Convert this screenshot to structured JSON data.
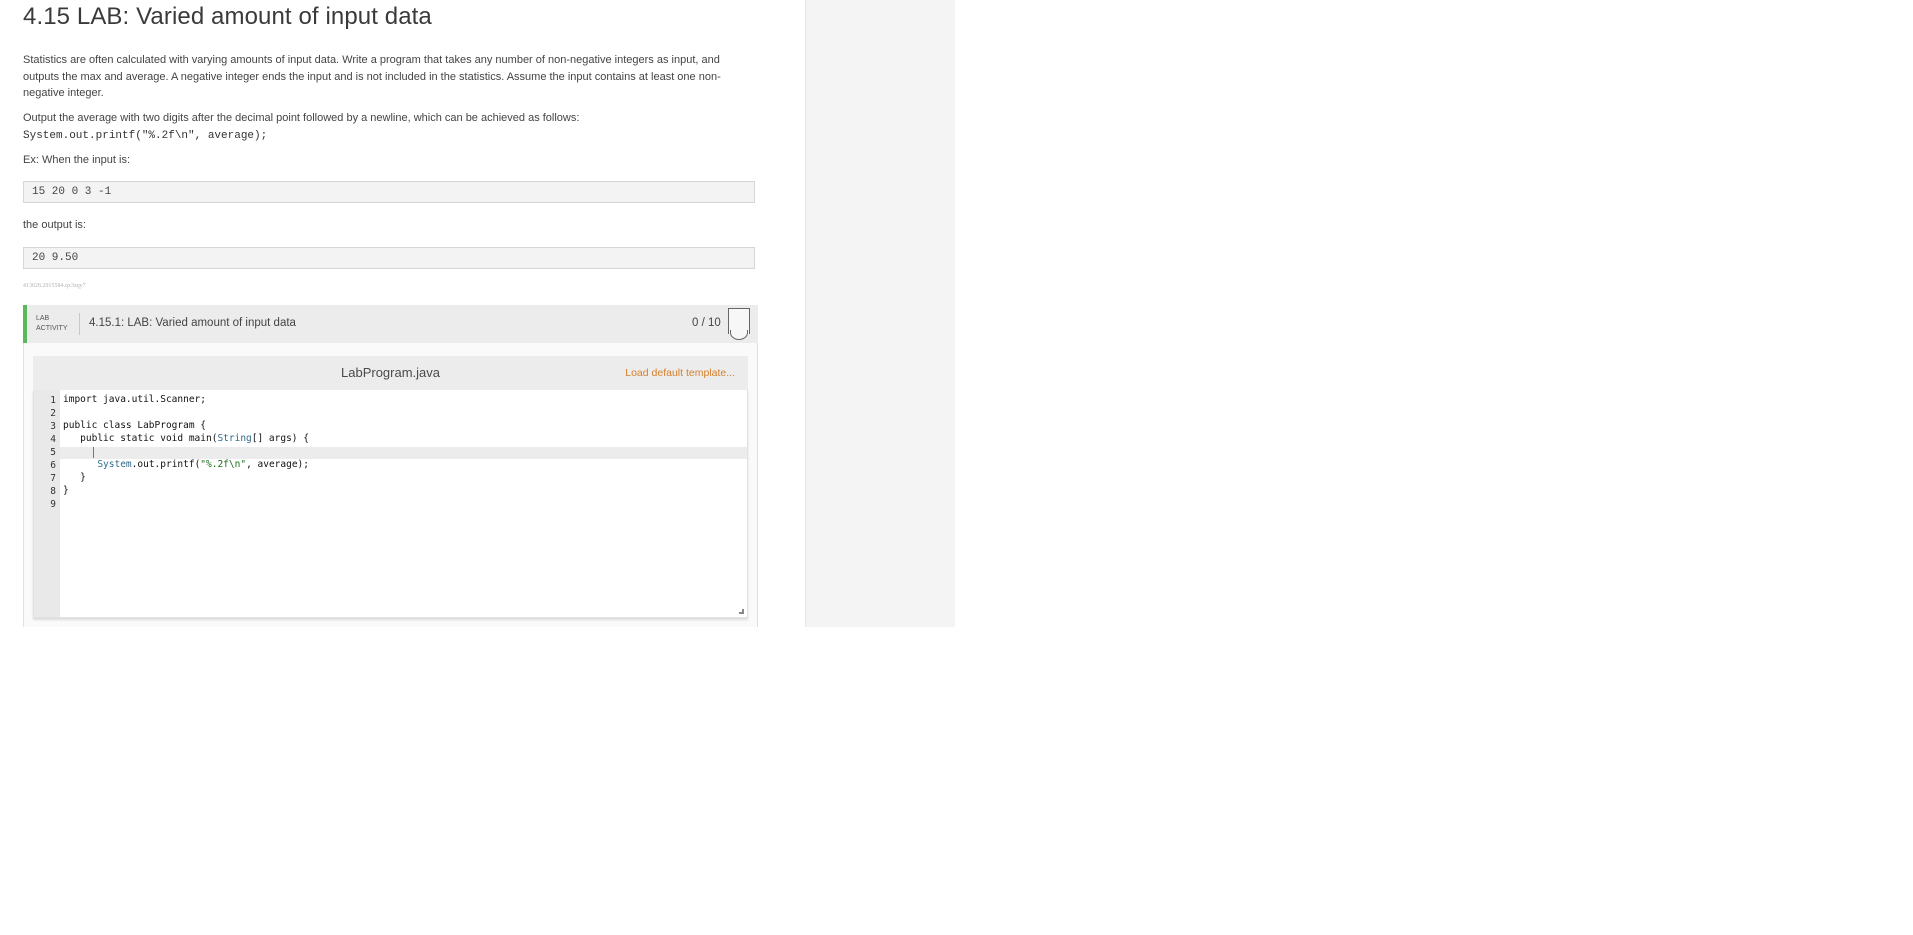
{
  "page": {
    "title": "4.15 LAB: Varied amount of input data",
    "para1": "Statistics are often calculated with varying amounts of input data. Write a program that takes any number of non-negative integers as input, and outputs the max and average. A negative integer ends the input and is not included in the statistics. Assume the input contains at least one non-negative integer.",
    "para2": "Output the average with two digits after the decimal point followed by a newline, which can be achieved as follows:",
    "printf_snippet": "System.out.printf(\"%.2f\\n\", average);",
    "ex_label": "Ex: When the input is:",
    "example_input": "15 20 0 3 -1",
    "output_label": "the output is:",
    "example_output": "20 9.50",
    "tiny_id": "413026.2915584.qx3zqy7"
  },
  "activity": {
    "type_line1": "LAB",
    "type_line2": "ACTIVITY",
    "title": "4.15.1: LAB: Varied amount of input data",
    "score": "0 / 10"
  },
  "editor": {
    "filename": "LabProgram.java",
    "load_template": "Load default template...",
    "line_numbers": [
      "1",
      "2",
      "3",
      "4",
      "5",
      "6",
      "7",
      "8",
      "9"
    ],
    "lines": {
      "l1": "import java.util.Scanner;",
      "l2": "",
      "l3": "public class LabProgram {",
      "l4a": "   public static void main(",
      "l4b": "String",
      "l4c": "[] args) {",
      "l5": "",
      "l6a": "      ",
      "l6b": "System",
      "l6c": ".out.printf(",
      "l6d": "\"%.2f\\n\"",
      "l6e": ", average);",
      "l7": "   }",
      "l8": "}",
      "l9": ""
    }
  }
}
